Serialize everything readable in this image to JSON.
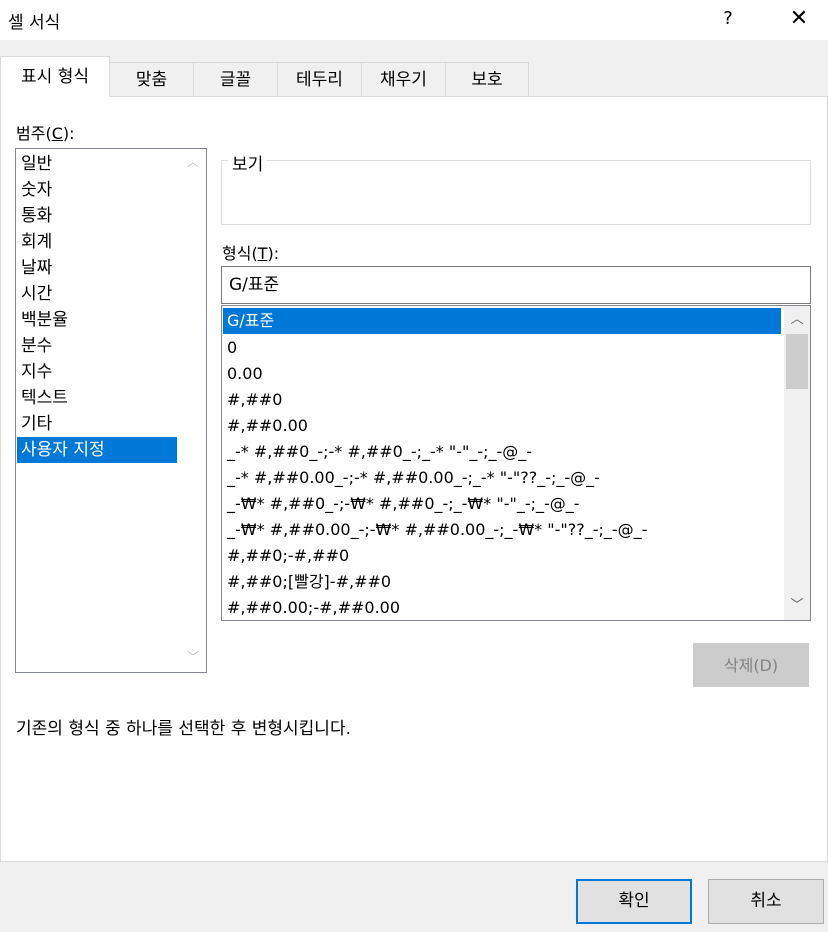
{
  "window": {
    "title": "셀 서식",
    "help": "?",
    "close": "✕"
  },
  "tabs": [
    {
      "label": "표시 형식"
    },
    {
      "label": "맞춤"
    },
    {
      "label": "글꼴"
    },
    {
      "label": "테두리"
    },
    {
      "label": "채우기"
    },
    {
      "label": "보호"
    }
  ],
  "category": {
    "label_text": "범주(",
    "label_key": "C",
    "label_end": "):",
    "items": [
      "일반",
      "숫자",
      "통화",
      "회계",
      "날짜",
      "시간",
      "백분율",
      "분수",
      "지수",
      "텍스트",
      "기타",
      "사용자 지정"
    ],
    "selected": "사용자 지정"
  },
  "preview": {
    "legend": "보기"
  },
  "format": {
    "label_text": "형식(",
    "label_key": "T",
    "label_end": "):",
    "value": "G/표준",
    "items": [
      "G/표준",
      "0",
      "0.00",
      "#,##0",
      "#,##0.00",
      "_-* #,##0_-;-* #,##0_-;_-* \"-\"_-;_-@_-",
      "_-* #,##0.00_-;-* #,##0.00_-;_-* \"-\"??_-;_-@_-",
      "_-₩* #,##0_-;-₩* #,##0_-;_-₩* \"-\"_-;_-@_-",
      "_-₩* #,##0.00_-;-₩* #,##0.00_-;_-₩* \"-\"??_-;_-@_-",
      "#,##0;-#,##0",
      "#,##0;[빨강]-#,##0",
      "#,##0.00;-#,##0.00"
    ],
    "selected": "G/표준"
  },
  "buttons": {
    "delete": "삭제(D)",
    "ok": "확인",
    "cancel": "취소"
  },
  "description": "기존의 형식 중 하나를 선택한 후 변형시킵니다.",
  "colors": {
    "selection": "#0078d7",
    "ok_border": "#0078d7"
  }
}
